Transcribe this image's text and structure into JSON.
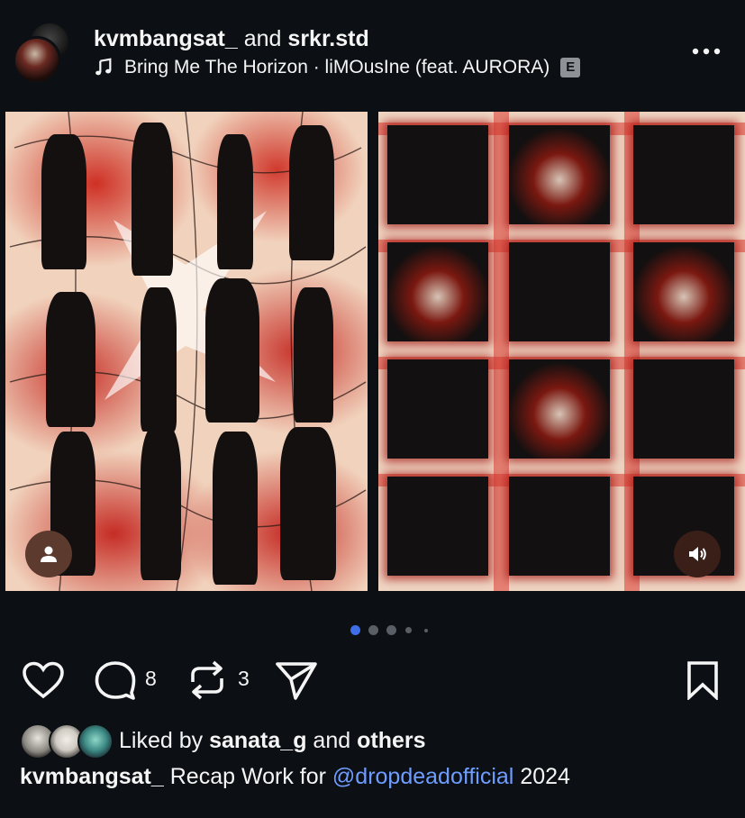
{
  "post": {
    "author": "kvmbangsat_",
    "and_text": "and",
    "collaborator": "srkr.std",
    "music": {
      "icon": "music-note-icon",
      "track": "Bring Me The Horizon · liMOusIne (feat. AURORA)",
      "explicit_badge": "E"
    },
    "carousel": {
      "total_dots": 5,
      "active_index": 0,
      "accent_color": "#3f6fe8"
    },
    "actions": {
      "comment_count": "8",
      "repost_count": "3"
    },
    "likes": {
      "prefix": "Liked by",
      "user": "sanata_g",
      "and_text": "and",
      "others": "others"
    },
    "caption": {
      "author": "kvmbangsat_",
      "text": "Recap Work for",
      "mention": "@dropdeadofficial",
      "suffix": "2024"
    }
  }
}
